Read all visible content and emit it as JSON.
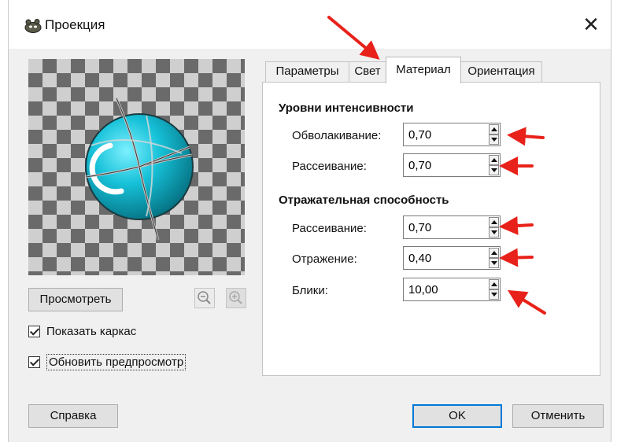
{
  "window": {
    "title": "Проекция",
    "close_glyph": "✕",
    "icon": "gimp-icon"
  },
  "preview": {
    "button_label": "Просмотреть",
    "zoom_out_icon": "zoom-out-icon",
    "zoom_in_icon": "zoom-in-icon",
    "sphere_color": "#16c1d8"
  },
  "checkboxes": [
    {
      "label": "Показать каркас",
      "checked": true
    },
    {
      "label": "Обновить предпросмотр",
      "checked": true
    }
  ],
  "tabs": [
    {
      "label": "Параметры",
      "active": false
    },
    {
      "label": "Свет",
      "active": false
    },
    {
      "label": "Материал",
      "active": true
    },
    {
      "label": "Ориентация",
      "active": false
    }
  ],
  "material": {
    "intensity": {
      "heading": "Уровни интенсивности",
      "fields": [
        {
          "label": "Обволакивание:",
          "value": "0,70"
        },
        {
          "label": "Рассеивание:",
          "value": "0,70"
        }
      ]
    },
    "reflectivity": {
      "heading": "Отражательная способность",
      "fields": [
        {
          "label": "Рассеивание:",
          "value": "0,70"
        },
        {
          "label": "Отражение:",
          "value": "0,40"
        },
        {
          "label": "Блики:",
          "value": "10,00"
        }
      ]
    }
  },
  "footer": {
    "help_label": "Справка",
    "ok_label": "OK",
    "cancel_label": "Отменить"
  },
  "colors": {
    "annotation_arrow": "#e8221a",
    "focus_border": "#0078d7"
  }
}
